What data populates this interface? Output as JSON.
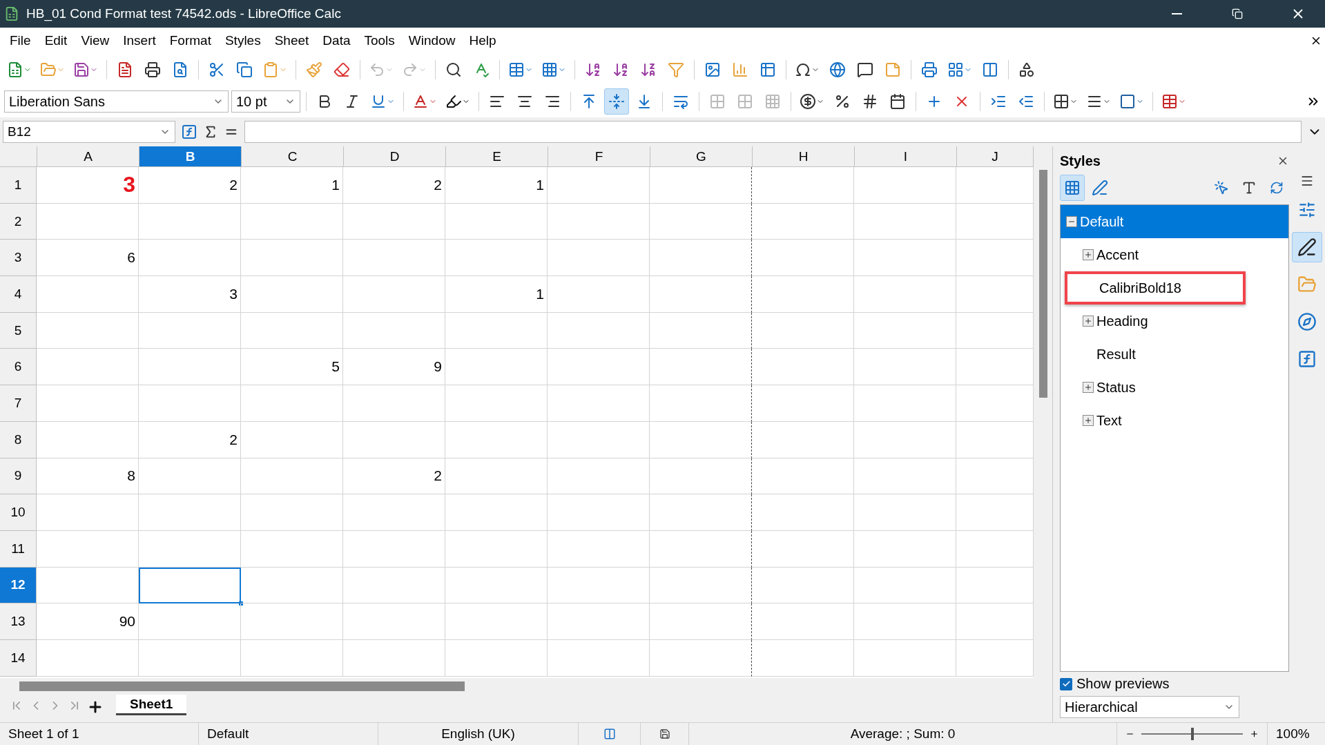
{
  "window": {
    "title": "HB_01 Cond Format test 74542.ods - LibreOffice Calc"
  },
  "menu": [
    "File",
    "Edit",
    "View",
    "Insert",
    "Format",
    "Styles",
    "Sheet",
    "Data",
    "Tools",
    "Window",
    "Help"
  ],
  "formatting": {
    "font_name": "Liberation Sans",
    "font_size": "10 pt"
  },
  "formula_bar": {
    "name_box": "B12"
  },
  "columns": [
    {
      "label": "A",
      "selected": false,
      "page_break": false
    },
    {
      "label": "B",
      "selected": true,
      "page_break": false
    },
    {
      "label": "C",
      "selected": false,
      "page_break": false
    },
    {
      "label": "D",
      "selected": false,
      "page_break": false
    },
    {
      "label": "E",
      "selected": false,
      "page_break": false
    },
    {
      "label": "F",
      "selected": false,
      "page_break": false
    },
    {
      "label": "G",
      "selected": false,
      "page_break": true
    },
    {
      "label": "H",
      "selected": false,
      "page_break": false
    },
    {
      "label": "I",
      "selected": false,
      "page_break": false
    },
    {
      "label": "J",
      "selected": false,
      "page_break": false
    }
  ],
  "rows": [
    {
      "label": "1",
      "selected": false,
      "cells": [
        {
          "value": "3",
          "highlighted": true,
          "selected": false
        },
        {
          "value": "2",
          "highlighted": false,
          "selected": false
        },
        {
          "value": "1",
          "highlighted": false,
          "selected": false
        },
        {
          "value": "2",
          "highlighted": false,
          "selected": false
        },
        {
          "value": "1",
          "highlighted": false,
          "selected": false
        }
      ]
    },
    {
      "label": "2",
      "selected": false,
      "cells": []
    },
    {
      "label": "3",
      "selected": false,
      "cells": [
        {
          "value": "6",
          "highlighted": false,
          "selected": false
        }
      ]
    },
    {
      "label": "4",
      "selected": false,
      "cells": [
        {
          "selected": false
        },
        {
          "value": "3",
          "highlighted": false,
          "selected": false
        },
        {
          "selected": false
        },
        {
          "selected": false
        },
        {
          "value": "1",
          "highlighted": false,
          "selected": false
        }
      ]
    },
    {
      "label": "5",
      "selected": false,
      "cells": []
    },
    {
      "label": "6",
      "selected": false,
      "cells": [
        {
          "selected": false
        },
        {
          "selected": false
        },
        {
          "value": "5",
          "highlighted": false,
          "selected": false
        },
        {
          "value": "9",
          "highlighted": false,
          "selected": false
        }
      ]
    },
    {
      "label": "7",
      "selected": false,
      "cells": []
    },
    {
      "label": "8",
      "selected": false,
      "cells": [
        {
          "selected": false
        },
        {
          "value": "2",
          "highlighted": false,
          "selected": false
        }
      ]
    },
    {
      "label": "9",
      "selected": false,
      "cells": [
        {
          "value": "8",
          "highlighted": false,
          "selected": false
        },
        {
          "selected": false
        },
        {
          "selected": false
        },
        {
          "value": "2",
          "highlighted": false,
          "selected": false
        }
      ]
    },
    {
      "label": "10",
      "selected": false,
      "cells": []
    },
    {
      "label": "11",
      "selected": false,
      "cells": []
    },
    {
      "label": "12",
      "selected": true,
      "cells": [
        {
          "selected": false
        },
        {
          "selected": true
        }
      ]
    },
    {
      "label": "13",
      "selected": false,
      "cells": [
        {
          "value": "90",
          "highlighted": false,
          "selected": false
        }
      ]
    },
    {
      "label": "14",
      "selected": false,
      "cells": []
    }
  ],
  "sheet_tabs": [
    {
      "label": "Sheet1",
      "selected": true
    }
  ],
  "sidebar": {
    "title": "Styles",
    "styles": [
      {
        "label": "Default",
        "kind": "group",
        "selected": true,
        "expanded": true,
        "annotated": false,
        "children": [
          {
            "label": "Accent",
            "kind": "group",
            "selected": false,
            "expanded": false,
            "annotated": false
          },
          {
            "label": "CalibriBold18",
            "kind": "style",
            "selected": false,
            "annotated": true
          },
          {
            "label": "Heading",
            "kind": "group",
            "selected": false,
            "expanded": false,
            "annotated": false
          },
          {
            "label": "Result",
            "kind": "style",
            "selected": false,
            "annotated": false
          },
          {
            "label": "Status",
            "kind": "group",
            "selected": false,
            "expanded": false,
            "annotated": false
          },
          {
            "label": "Text",
            "kind": "group",
            "selected": false,
            "expanded": false,
            "annotated": false
          }
        ]
      }
    ],
    "show_previews": {
      "label": "Show previews",
      "checked": true
    },
    "filter": "Hierarchical"
  },
  "status_bar": {
    "sheet": "Sheet 1 of 1",
    "page_style": "Default",
    "language": "English (UK)",
    "summary": "Average: ; Sum: 0",
    "zoom": {
      "level": 0.5
    },
    "zoom_reading": "100%"
  }
}
